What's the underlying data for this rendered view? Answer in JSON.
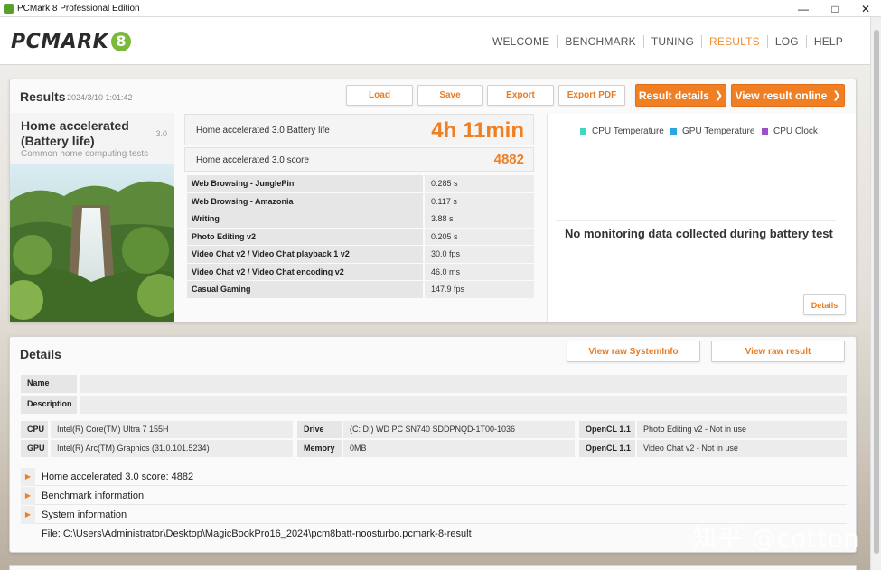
{
  "window": {
    "title": "PCMark 8 Professional Edition"
  },
  "header": {
    "logo": "PCMARK",
    "logo_badge": "8",
    "nav": [
      {
        "label": "WELCOME",
        "active": false
      },
      {
        "label": "BENCHMARK",
        "active": false
      },
      {
        "label": "TUNING",
        "active": false
      },
      {
        "label": "RESULTS",
        "active": true
      },
      {
        "label": "LOG",
        "active": false
      },
      {
        "label": "HELP",
        "active": false
      }
    ]
  },
  "results": {
    "title": "Results",
    "date": "2024/3/10 1:01:42",
    "buttons": {
      "load": "Load",
      "save": "Save",
      "export": "Export",
      "export_pdf": "Export PDF",
      "result_details": "Result details",
      "view_online": "View result online"
    },
    "test": {
      "name": "Home accelerated (Battery life)",
      "version": "3.0",
      "subtitle": "Common home computing tests"
    },
    "battery": {
      "label": "Home accelerated 3.0 Battery life",
      "value": "4h 11min"
    },
    "score": {
      "label": "Home accelerated 3.0 score",
      "value": "4882"
    },
    "rows": [
      {
        "name": "Web Browsing - JunglePin",
        "value": "0.285 s"
      },
      {
        "name": "Web Browsing - Amazonia",
        "value": "0.117 s"
      },
      {
        "name": "Writing",
        "value": "3.88 s"
      },
      {
        "name": "Photo Editing v2",
        "value": "0.205 s"
      },
      {
        "name": "Video Chat v2 / Video Chat playback 1 v2",
        "value": "30.0 fps"
      },
      {
        "name": "Video Chat v2 / Video Chat encoding v2",
        "value": "46.0 ms"
      },
      {
        "name": "Casual Gaming",
        "value": "147.9 fps"
      }
    ],
    "monitoring": {
      "legend": [
        {
          "label": "CPU Temperature",
          "color": "#3cd8c0"
        },
        {
          "label": "GPU Temperature",
          "color": "#2aa6e0"
        },
        {
          "label": "CPU Clock",
          "color": "#9b4fc9"
        }
      ],
      "message": "No monitoring data collected during battery test",
      "details_button": "Details"
    }
  },
  "details": {
    "title": "Details",
    "view_systeminfo": "View raw SystemInfo",
    "view_result": "View raw result",
    "name_label": "Name",
    "name_value": "",
    "description_label": "Description",
    "description_value": "",
    "cpu_label": "CPU",
    "cpu_value": "Intel(R) Core(TM) Ultra 7 155H",
    "gpu_label": "GPU",
    "gpu_value": "Intel(R) Arc(TM) Graphics (31.0.101.5234)",
    "drive_label": "Drive",
    "drive_value": "(C: D:) WD PC SN740 SDDPNQD-1T00-1036",
    "memory_label": "Memory",
    "memory_value": "0MB",
    "opencl1_label": "OpenCL 1.1",
    "opencl1_value": "Photo Editing v2 - Not in use",
    "opencl2_label": "OpenCL 1.1",
    "opencl2_value": "Video Chat v2 - Not in use",
    "expanders": [
      "Home accelerated 3.0 score: 4882",
      "Benchmark information",
      "System information"
    ],
    "file": "File: C:\\Users\\Administrator\\Desktop\\MagicBookPro16_2024\\pcm8batt-noosturbo.pcmark-8-result"
  },
  "watermark": "知乎 @cotton"
}
